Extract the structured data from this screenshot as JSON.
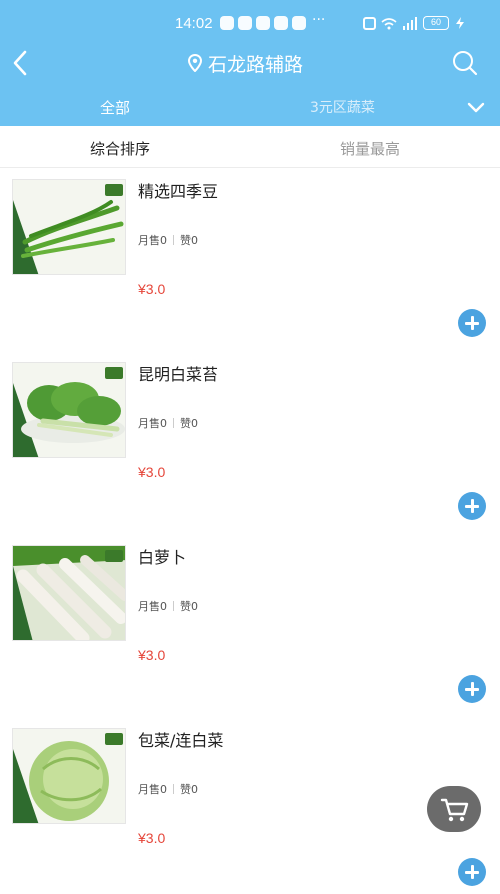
{
  "status_bar": {
    "time": "14:02",
    "dots": "···",
    "battery": "60"
  },
  "header": {
    "location": "石龙路辅路",
    "tabs": [
      {
        "label": "全部",
        "active": true
      },
      {
        "label": "3元区蔬菜",
        "active": false
      }
    ],
    "colors": {
      "bar": "#6cc2f2",
      "accent": "#4ba3e0"
    }
  },
  "sort": {
    "default_label": "综合排序",
    "sales_label": "销量最高"
  },
  "products": [
    {
      "name": "精选四季豆",
      "monthly_sales": "月售0",
      "likes": "赞0",
      "price": "¥3.0",
      "image": "green-beans"
    },
    {
      "name": "昆明白菜苔",
      "monthly_sales": "月售0",
      "likes": "赞0",
      "price": "¥3.0",
      "image": "choy-sum"
    },
    {
      "name": "白萝卜",
      "monthly_sales": "月售0",
      "likes": "赞0",
      "price": "¥3.0",
      "image": "white-radish"
    },
    {
      "name": "包菜/连白菜",
      "monthly_sales": "月售0",
      "likes": "赞0",
      "price": "¥3.0",
      "image": "cabbage"
    }
  ],
  "price_color": "#e5463a",
  "icons": {
    "back": "chevron-left-icon",
    "location": "location-pin-icon",
    "search": "search-icon",
    "toggle": "chevron-down-icon",
    "add": "plus-icon",
    "cart": "cart-icon"
  }
}
